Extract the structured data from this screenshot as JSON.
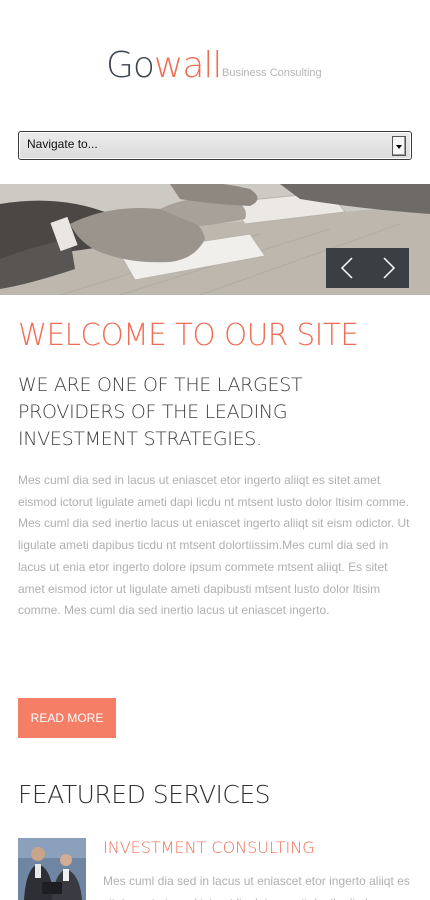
{
  "header": {
    "logo_part1": "Go",
    "logo_part2": "wall",
    "tagline": "Business Consulting",
    "logo_color_dark": "#3f4651",
    "accent_color": "#f06d55"
  },
  "nav": {
    "select_label": "Navigate to..."
  },
  "slider": {
    "prev_icon": "chevron-left-icon",
    "next_icon": "chevron-right-icon"
  },
  "main": {
    "welcome_title": "WELCOME TO OUR SITE",
    "subheading": "WE ARE ONE OF THE LARGEST PROVIDERS OF THE LEADING INVESTMENT STRATEGIES.",
    "body": "Mes cuml dia sed in lacus ut eniascet etor ingerto aliiqt es sitet amet eismod ictorut ligulate ameti dapi licdu nt mtsent lusto dolor ltisim comme. Mes cuml dia sed inertio lacus ut eniascet ingerto aliiqt sit eism odictor. Ut ligulate ameti dapibus ticdu nt mtsent dolortiissim.Mes cuml dia sed in lacus ut enia etor ingerto dolore ipsum commete mtsent aliiqt. Es sitet amet eismod ictor ut ligulate ameti dapibusti mtsent lusto dolor ltisim comme. Mes cuml dia sed inertio lacus ut eniascet ingerto.",
    "read_more_label": "READ MORE",
    "button_color": "#f47e66"
  },
  "featured": {
    "title": "FEATURED SERVICES",
    "services": [
      {
        "title": "INVESTMENT CONSULTING",
        "text": "Mes cuml dia sed in lacus ut eniascet etor ingerto aliiqt es sitet amet eismod ictorut ligulate ameti dapibu licdu"
      }
    ]
  }
}
